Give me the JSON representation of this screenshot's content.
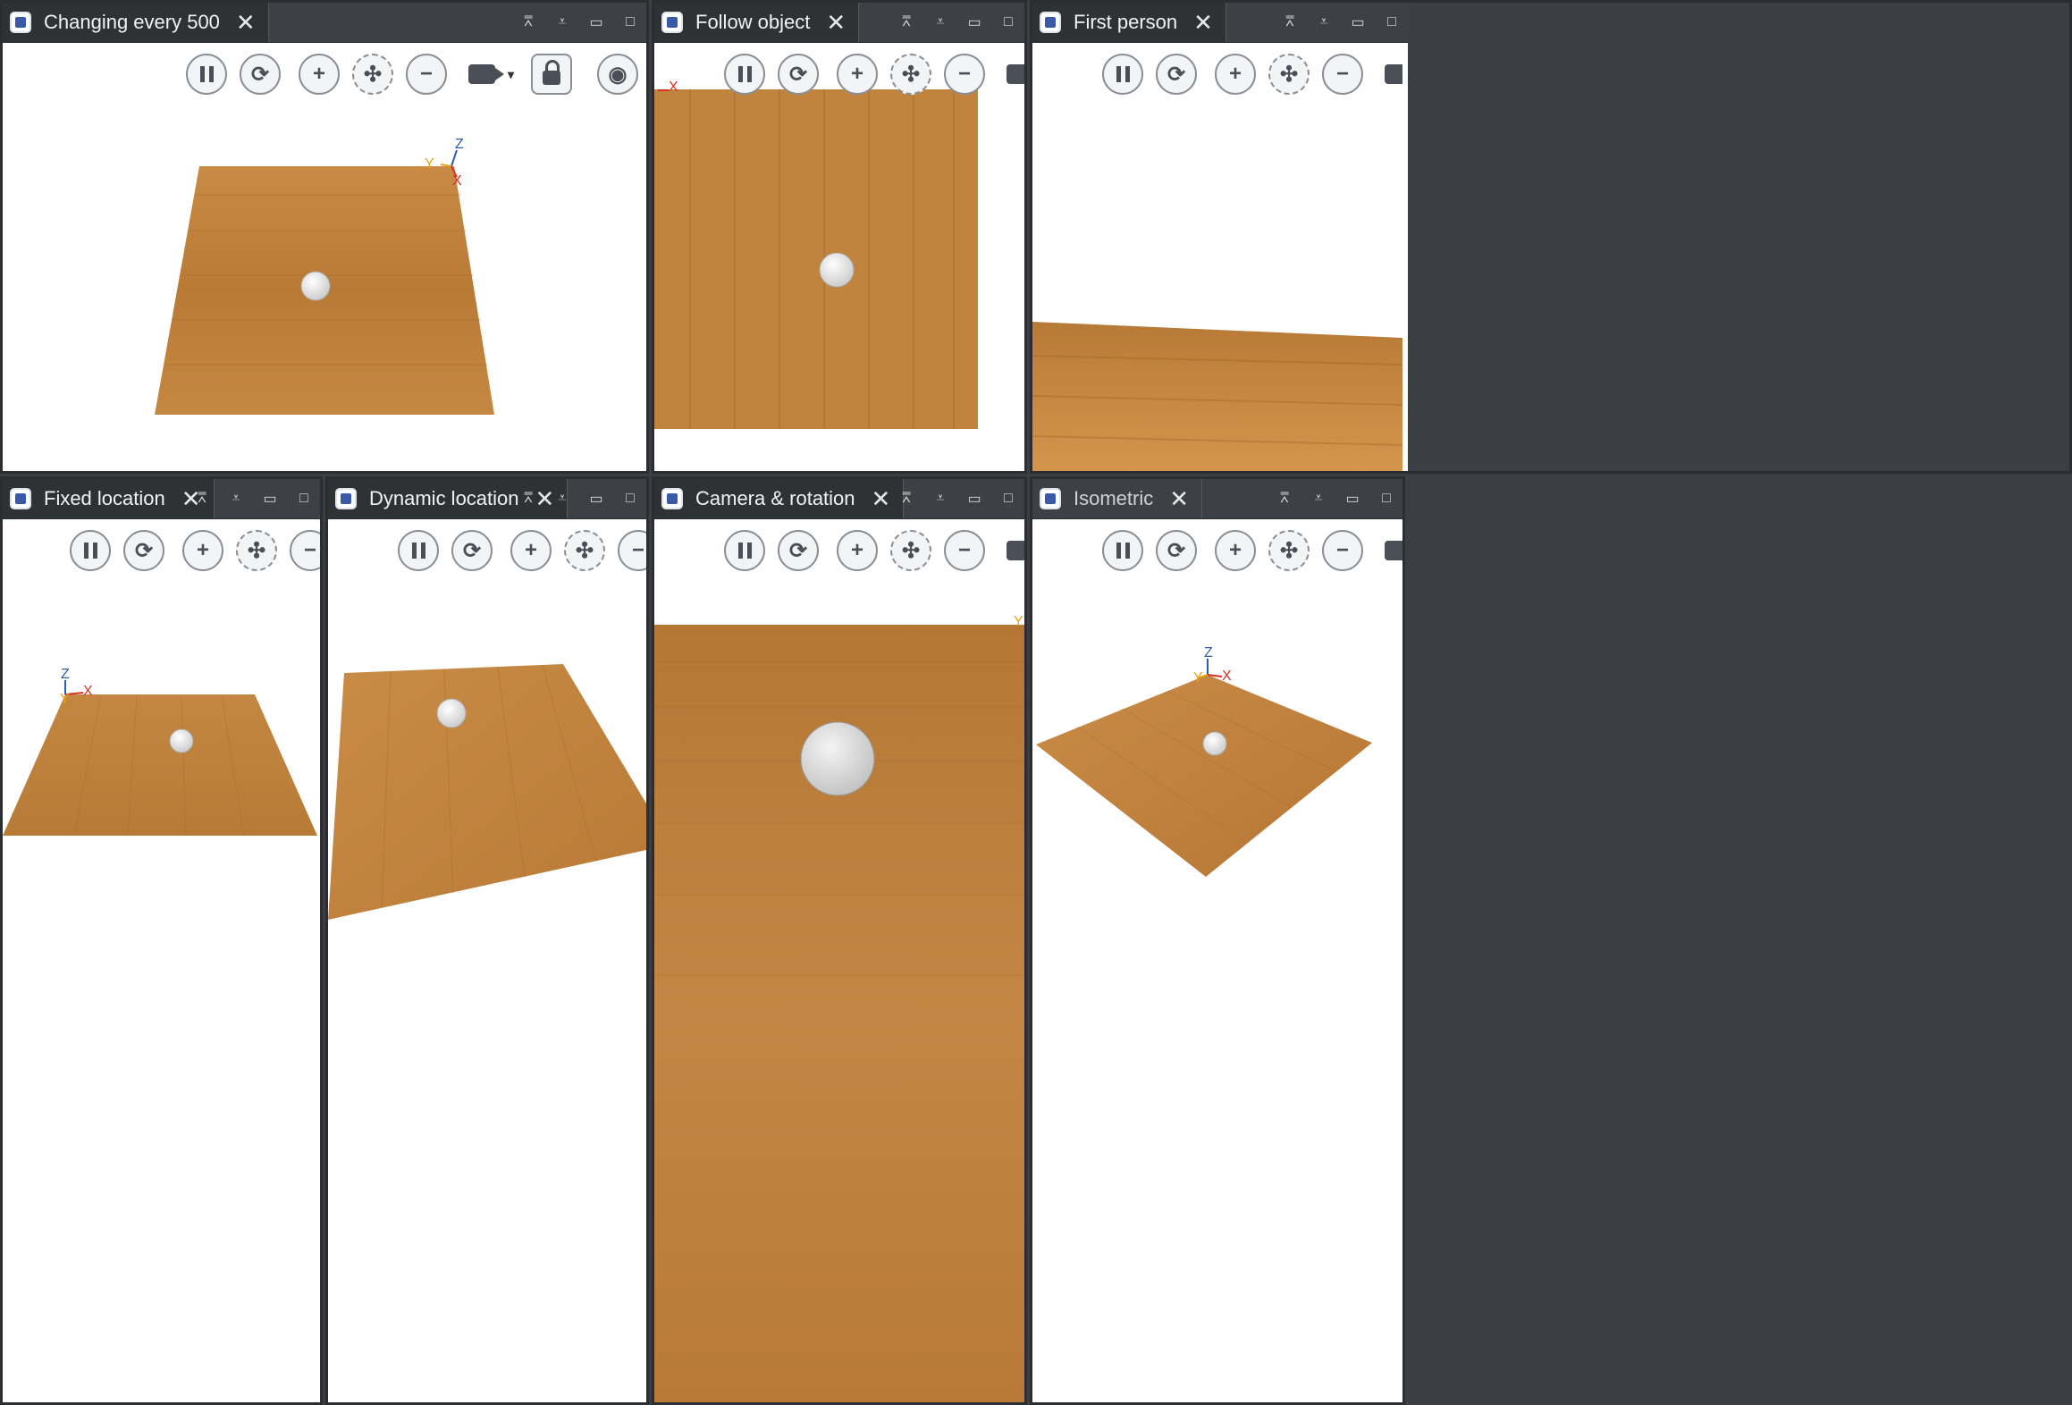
{
  "views": [
    {
      "title": "Changing every 500",
      "tools": [
        "pause-icon",
        "rotate-icon",
        "zoom-in-icon",
        "fit-icon",
        "zoom-out-icon",
        "camera-icon",
        "lock-icon",
        "screenshot-icon",
        "texture-icon",
        "fullscreen-icon",
        "layers-icon"
      ]
    },
    {
      "title": "Follow object",
      "tools": [
        "pause-icon",
        "rotate-icon",
        "zoom-in-icon",
        "fit-icon",
        "zoom-out-icon",
        "camera-icon",
        "lock-icon"
      ]
    },
    {
      "title": "First person",
      "tools": [
        "pause-icon",
        "rotate-icon",
        "zoom-in-icon",
        "fit-icon",
        "zoom-out-icon",
        "camera-icon",
        "lock-icon"
      ]
    },
    {
      "title": "Fixed location",
      "tools": [
        "pause-icon",
        "rotate-icon",
        "zoom-in-icon",
        "fit-icon",
        "zoom-out-icon"
      ]
    },
    {
      "title": "Dynamic location",
      "tools": [
        "pause-icon",
        "rotate-icon",
        "zoom-in-icon",
        "fit-icon",
        "zoom-out-icon"
      ]
    },
    {
      "title": "Camera & rotation",
      "tools": [
        "pause-icon",
        "rotate-icon",
        "zoom-in-icon",
        "fit-icon",
        "zoom-out-icon",
        "camera-icon",
        "lock-icon"
      ]
    },
    {
      "title": "Isometric",
      "tools": [
        "pause-icon",
        "rotate-icon",
        "zoom-in-icon",
        "fit-icon",
        "zoom-out-icon",
        "camera-icon",
        "lock-icon"
      ]
    }
  ],
  "axes": {
    "x": "X",
    "y": "Y",
    "z": "Z"
  },
  "colors": {
    "wood": "#c8893e",
    "wood_dark": "#b06f2a",
    "axis_x": "#d93025",
    "axis_y": "#e8a21a",
    "axis_z": "#2a5fb0"
  }
}
